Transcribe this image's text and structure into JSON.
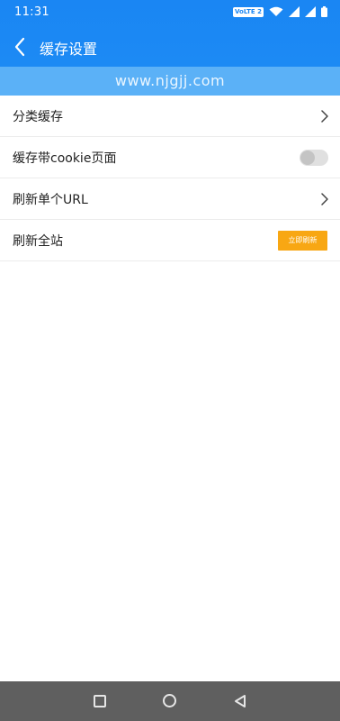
{
  "status_bar": {
    "time": "11:31",
    "volte": "VoLTE 2",
    "icons": [
      "wifi-icon",
      "signal-icon",
      "signal-icon",
      "battery-icon"
    ]
  },
  "app_bar": {
    "back_icon": "chevron-left-icon",
    "title": "缓存设置"
  },
  "banner": {
    "text": "www.njgjj.com"
  },
  "settings": {
    "items": [
      {
        "label": "分类缓存",
        "control": "chevron-right-icon"
      },
      {
        "label": "缓存带cookie页面",
        "control": "toggle",
        "enabled": false
      },
      {
        "label": "刷新单个URL",
        "control": "chevron-right-icon"
      },
      {
        "label": "刷新全站",
        "control": "button",
        "button_label": "立即刷新"
      }
    ]
  },
  "nav_bar": {
    "icons": [
      "recents-square-icon",
      "home-circle-icon",
      "back-triangle-icon"
    ]
  },
  "colors": {
    "primary": "#1a86f3",
    "banner": "#5bb1f7",
    "action": "#f8a713",
    "navbar": "#5f5f5f"
  }
}
